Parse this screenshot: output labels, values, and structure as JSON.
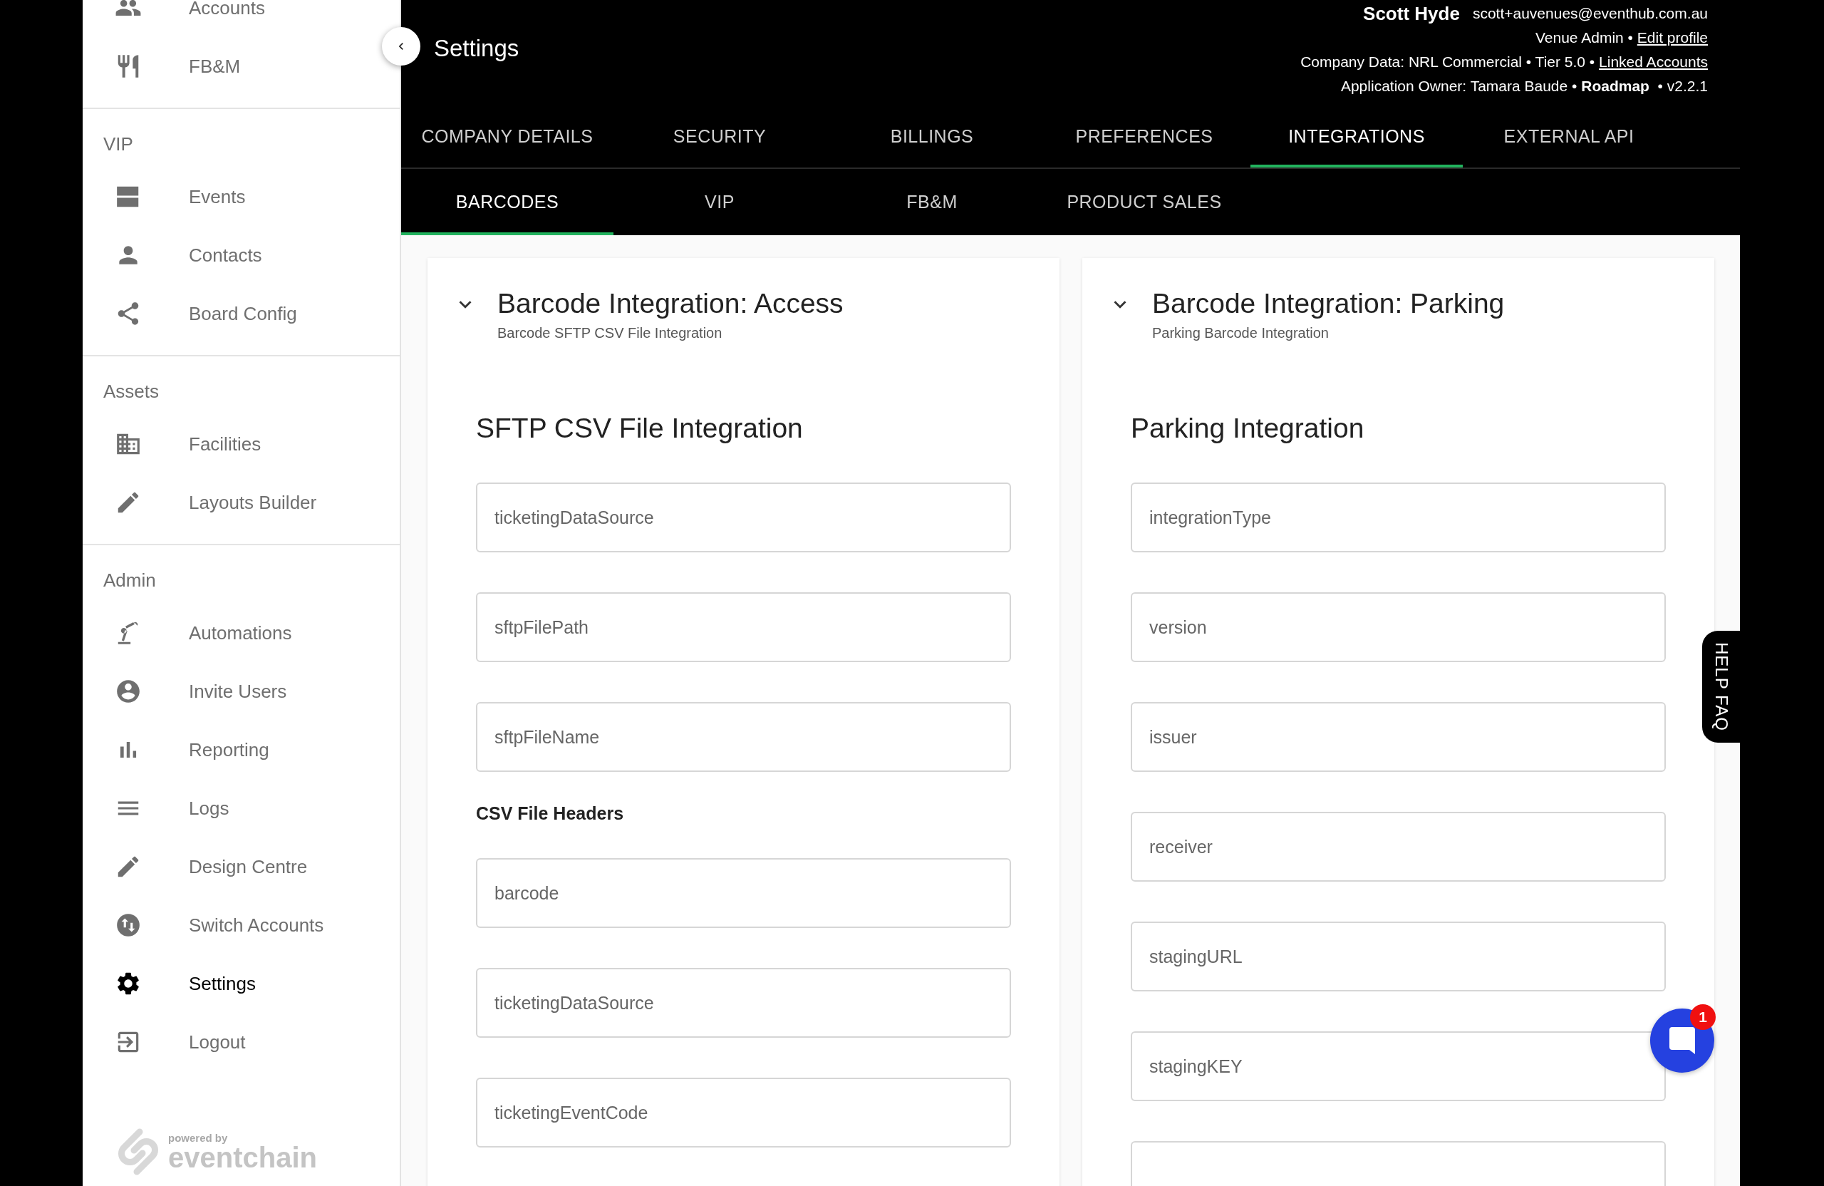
{
  "sidebar": {
    "groups": [
      {
        "items": [
          {
            "label": "Accounts",
            "selected": false
          },
          {
            "label": "FB&M",
            "selected": false
          }
        ]
      },
      {
        "heading": "VIP",
        "items": [
          {
            "label": "Events",
            "selected": false
          },
          {
            "label": "Contacts",
            "selected": false
          },
          {
            "label": "Board Config",
            "selected": false
          }
        ]
      },
      {
        "heading": "Assets",
        "items": [
          {
            "label": "Facilities",
            "selected": false
          },
          {
            "label": "Layouts Builder",
            "selected": false
          }
        ]
      },
      {
        "heading": "Admin",
        "items": [
          {
            "label": "Automations",
            "selected": false
          },
          {
            "label": "Invite Users",
            "selected": false
          },
          {
            "label": "Reporting",
            "selected": false
          },
          {
            "label": "Logs",
            "selected": false
          },
          {
            "label": "Design Centre",
            "selected": false
          },
          {
            "label": "Switch Accounts",
            "selected": false
          },
          {
            "label": "Settings",
            "selected": true
          },
          {
            "label": "Logout",
            "selected": false
          }
        ]
      }
    ],
    "logo": {
      "tagline": "powered by",
      "name": "eventchain"
    }
  },
  "header": {
    "title": "Settings",
    "user": {
      "name": "Scott Hyde",
      "email": "scott+auvenues@eventhub.com.au",
      "role": "Venue Admin •",
      "edit_link": "Edit profile",
      "company": "Company Data: NRL Commercial • Tier 5.0 •",
      "linked_link": "Linked Accounts",
      "owner": "Application Owner: Tamara Baude •",
      "roadmap": "Roadmap",
      "version": "• v2.2.1"
    }
  },
  "tabs": [
    {
      "label": "COMPANY DETAILS",
      "selected": false
    },
    {
      "label": "SECURITY",
      "selected": false
    },
    {
      "label": "BILLINGS",
      "selected": false
    },
    {
      "label": "PREFERENCES",
      "selected": false
    },
    {
      "label": "INTEGRATIONS",
      "selected": true
    },
    {
      "label": "EXTERNAL API",
      "selected": false
    }
  ],
  "subtabs": [
    {
      "label": "BARCODES",
      "selected": true
    },
    {
      "label": "VIP",
      "selected": false
    },
    {
      "label": "FB&M",
      "selected": false
    },
    {
      "label": "PRODUCT SALES",
      "selected": false
    }
  ],
  "cards": [
    {
      "title": "Barcode Integration: Access",
      "subtitle": "Barcode SFTP CSV File Integration",
      "expanded": true,
      "blocks": [
        {
          "kind": "section_title",
          "text": "SFTP CSV File Integration"
        },
        {
          "kind": "field",
          "placeholder": "ticketingDataSource"
        },
        {
          "kind": "field",
          "placeholder": "sftpFilePath"
        },
        {
          "kind": "field",
          "placeholder": "sftpFileName"
        },
        {
          "kind": "subheading",
          "text": "CSV File Headers"
        },
        {
          "kind": "field",
          "placeholder": "barcode"
        },
        {
          "kind": "field",
          "placeholder": "ticketingDataSource"
        },
        {
          "kind": "field",
          "placeholder": "ticketingEventCode"
        }
      ]
    },
    {
      "title": "Barcode Integration: Parking",
      "subtitle": "Parking Barcode Integration",
      "expanded": true,
      "blocks": [
        {
          "kind": "section_title",
          "text": "Parking Integration"
        },
        {
          "kind": "field",
          "placeholder": "integrationType"
        },
        {
          "kind": "field",
          "placeholder": "version"
        },
        {
          "kind": "field",
          "placeholder": "issuer"
        },
        {
          "kind": "field",
          "placeholder": "receiver"
        },
        {
          "kind": "field",
          "placeholder": "stagingURL"
        },
        {
          "kind": "field",
          "placeholder": "stagingKEY"
        },
        {
          "kind": "cut_field"
        }
      ]
    }
  ],
  "help_tab": {
    "label": "HELP FAQ"
  },
  "chat": {
    "badge": "1"
  }
}
